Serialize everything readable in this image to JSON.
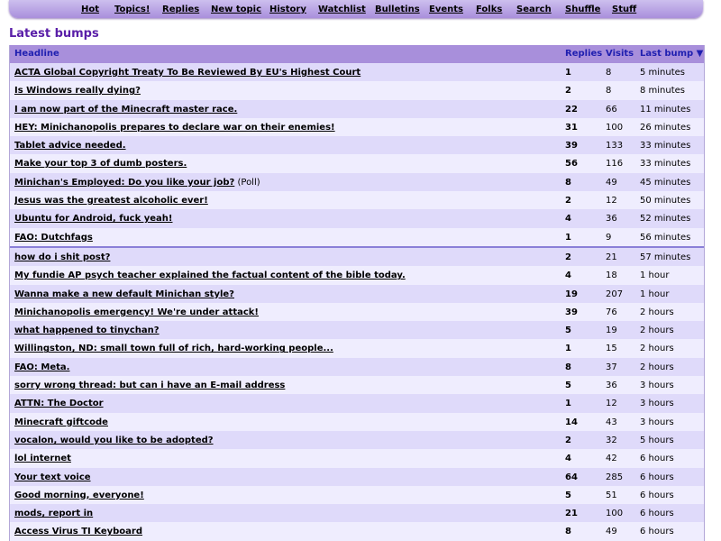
{
  "nav": {
    "items": [
      {
        "key": "hot",
        "label": "Hot"
      },
      {
        "key": "topics",
        "label": "Topics!"
      },
      {
        "key": "replies",
        "label": "Replies"
      },
      {
        "key": "new-topic",
        "label": "New topic"
      },
      {
        "key": "history",
        "label": "History"
      },
      {
        "key": "watchlist",
        "label": "Watchlist"
      },
      {
        "key": "bulletins",
        "label": "Bulletins"
      },
      {
        "key": "events",
        "label": "Events"
      },
      {
        "key": "folks",
        "label": "Folks"
      },
      {
        "key": "search",
        "label": "Search"
      },
      {
        "key": "shuffle",
        "label": "Shuffle"
      },
      {
        "key": "stuff",
        "label": "Stuff"
      }
    ]
  },
  "page": {
    "title": "Latest bumps"
  },
  "table": {
    "headers": {
      "headline": "Headline",
      "replies": "Replies",
      "visits": "Visits",
      "last_bump": "Last bump ▼"
    },
    "rows": [
      {
        "headline": "ACTA Global Copyright Treaty To Be Reviewed By EU's Highest Court",
        "suffix": "",
        "replies": "1",
        "visits": "8",
        "last_bump": "5 minutes"
      },
      {
        "headline": "Is Windows really dying?",
        "suffix": "",
        "replies": "2",
        "visits": "8",
        "last_bump": "8 minutes"
      },
      {
        "headline": "I am now part of the Minecraft master race.",
        "suffix": "",
        "replies": "22",
        "visits": "66",
        "last_bump": "11 minutes"
      },
      {
        "headline": "HEY: Minichanopolis prepares to declare war on their enemies!",
        "suffix": "",
        "replies": "31",
        "visits": "100",
        "last_bump": "26 minutes"
      },
      {
        "headline": "Tablet advice needed.",
        "suffix": "",
        "replies": "39",
        "visits": "133",
        "last_bump": "33 minutes"
      },
      {
        "headline": "Make your top 3 of dumb posters.",
        "suffix": "",
        "replies": "56",
        "visits": "116",
        "last_bump": "33 minutes"
      },
      {
        "headline": "Minichan's Employed: Do you like your job?",
        "suffix": " (Poll)",
        "replies": "8",
        "visits": "49",
        "last_bump": "45 minutes"
      },
      {
        "headline": "Jesus was the greatest alcoholic ever!",
        "suffix": "",
        "replies": "2",
        "visits": "12",
        "last_bump": "50 minutes"
      },
      {
        "headline": "Ubuntu for Android, fuck yeah!",
        "suffix": "",
        "replies": "4",
        "visits": "36",
        "last_bump": "52 minutes"
      },
      {
        "headline": "FAO: Dutchfags",
        "suffix": "",
        "replies": "1",
        "visits": "9",
        "last_bump": "56 minutes"
      },
      {
        "headline": "how do i shit post?",
        "suffix": "",
        "replies": "2",
        "visits": "21",
        "last_bump": "57 minutes"
      },
      {
        "headline": "My fundie AP psych teacher explained the factual content of the bible today.",
        "suffix": "",
        "replies": "4",
        "visits": "18",
        "last_bump": "1 hour"
      },
      {
        "headline": "Wanna make a new default Minichan style?",
        "suffix": "",
        "replies": "19",
        "visits": "207",
        "last_bump": "1 hour"
      },
      {
        "headline": "Minichanopolis emergency! We're under attack!",
        "suffix": "",
        "replies": "39",
        "visits": "76",
        "last_bump": "2 hours"
      },
      {
        "headline": "what happened to tinychan?",
        "suffix": "",
        "replies": "5",
        "visits": "19",
        "last_bump": "2 hours"
      },
      {
        "headline": "Willingston, ND: small town full of rich, hard-working people...",
        "suffix": "",
        "replies": "1",
        "visits": "15",
        "last_bump": "2 hours"
      },
      {
        "headline": "FAO: Meta.",
        "suffix": "",
        "replies": "8",
        "visits": "37",
        "last_bump": "2 hours"
      },
      {
        "headline": "sorry wrong thread: but can i have an E-mail address",
        "suffix": "",
        "replies": "5",
        "visits": "36",
        "last_bump": "3 hours"
      },
      {
        "headline": "ATTN: The Doctor",
        "suffix": "",
        "replies": "1",
        "visits": "12",
        "last_bump": "3 hours"
      },
      {
        "headline": "Minecraft giftcode",
        "suffix": "",
        "replies": "14",
        "visits": "43",
        "last_bump": "3 hours"
      },
      {
        "headline": "vocalon, would you like to be adopted?",
        "suffix": "",
        "replies": "2",
        "visits": "32",
        "last_bump": "5 hours"
      },
      {
        "headline": "lol internet",
        "suffix": "",
        "replies": "4",
        "visits": "42",
        "last_bump": "6 hours"
      },
      {
        "headline": "Your text voice",
        "suffix": "",
        "replies": "64",
        "visits": "285",
        "last_bump": "6 hours"
      },
      {
        "headline": "Good morning, everyone!",
        "suffix": "",
        "replies": "5",
        "visits": "51",
        "last_bump": "6 hours"
      },
      {
        "headline": "mods, report in",
        "suffix": "",
        "replies": "21",
        "visits": "100",
        "last_bump": "6 hours"
      },
      {
        "headline": "Access Virus TI Keyboard",
        "suffix": "",
        "replies": "8",
        "visits": "49",
        "last_bump": "6 hours"
      }
    ]
  }
}
